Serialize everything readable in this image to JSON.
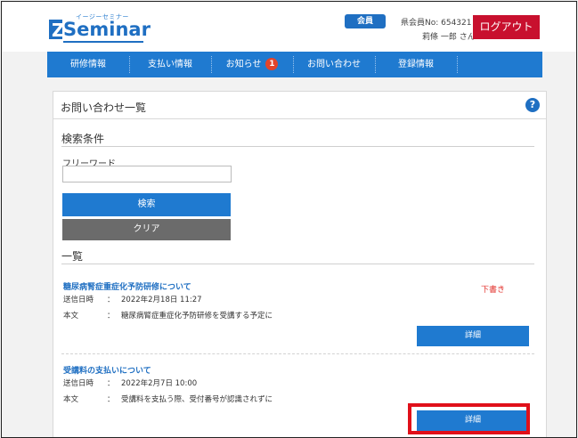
{
  "header": {
    "logo_sub": "イージーセミナー",
    "logo_word": "Seminar",
    "logo_mark": "Z",
    "member_badge": "会員",
    "member_no": "県会員No: 654321",
    "member_name": "莉條 一郎 さん",
    "logout_label": "ログアウト"
  },
  "nav": {
    "items": [
      {
        "label": "研修情報"
      },
      {
        "label": "支払い情報"
      },
      {
        "label": "お知らせ",
        "badge": "1"
      },
      {
        "label": "お問い合わせ"
      },
      {
        "label": "登録情報"
      }
    ]
  },
  "page": {
    "title": "お問い合わせ一覧",
    "help_icon": "question-circle-icon"
  },
  "search": {
    "section_title": "検索条件",
    "freeword_label": "フリーワード",
    "freeword_value": "",
    "search_label": "検索",
    "clear_label": "クリア"
  },
  "list": {
    "section_title": "一覧",
    "sent_label": "送信日時",
    "body_label": "本文",
    "separator": "：",
    "detail_label": "詳細",
    "items": [
      {
        "subject": "糖尿病腎症重症化予防研修について",
        "status": "下書き",
        "sent": "2022年2月18日 11:27",
        "body": "糖尿病腎症重症化予防研修を受講する予定に"
      },
      {
        "subject": "受講料の支払いについて",
        "status": "",
        "sent": "2022年2月7日 10:00",
        "body": "受講料を支払う際、受付番号が認識されずに"
      }
    ]
  },
  "colors": {
    "brand_blue": "#1f7ad0",
    "logout_red": "#c8102e",
    "highlight_red": "#e0101a",
    "draft_red": "#e3342f"
  }
}
